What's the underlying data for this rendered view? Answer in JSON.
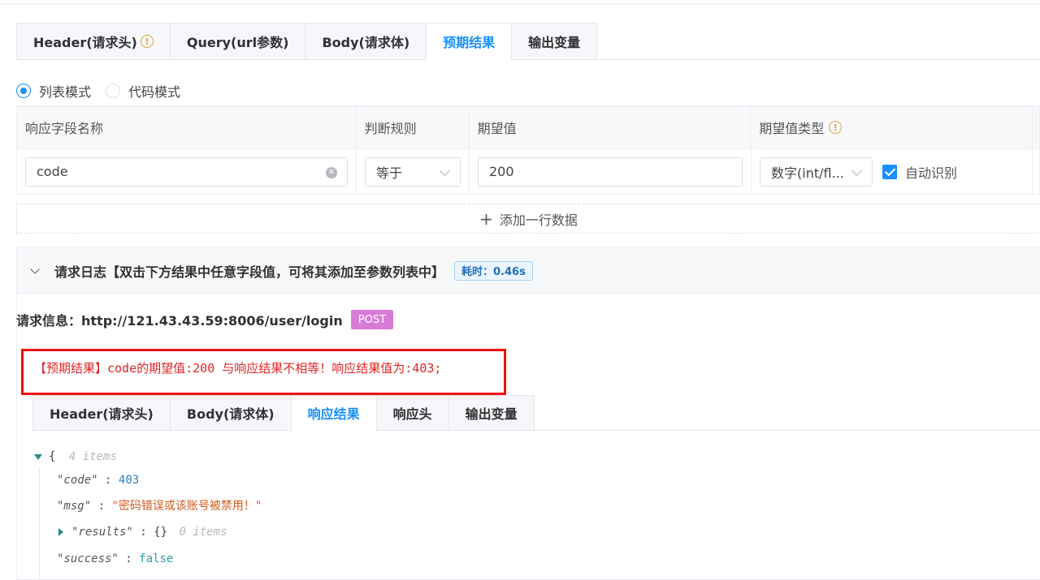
{
  "top_tabs": [
    {
      "label": "Header(请求头)",
      "has_warning": true
    },
    {
      "label": "Query(url参数)"
    },
    {
      "label": "Body(请求体)"
    },
    {
      "label": "预期结果",
      "active": true
    },
    {
      "label": "输出变量"
    }
  ],
  "mode": {
    "list_label": "列表模式",
    "code_label": "代码模式",
    "selected": "列表模式"
  },
  "table": {
    "headers": [
      "响应字段名称",
      "判断规则",
      "期望值",
      "期望值类型"
    ],
    "row": {
      "field_name": "code",
      "rule": "等于",
      "expected_value": "200",
      "value_type": "数字(int/fl...",
      "auto_detect_label": "自动识别",
      "auto_detect_checked": true
    },
    "add_row_label": "添加一行数据"
  },
  "log": {
    "title": "请求日志【双击下方结果中任意字段值，可将其添加至参数列表中】",
    "time_badge": "耗时：0.46s",
    "request_info_label": "请求信息：http://121.43.43.59:8006/user/login",
    "method_badge": "POST",
    "error_message": "【预期结果】code的期望值:200 与响应结果不相等！响应结果值为:403;",
    "tabs": [
      {
        "label": "Header(请求头)"
      },
      {
        "label": "Body(请求体)"
      },
      {
        "label": "响应结果",
        "active": true
      },
      {
        "label": "响应头"
      },
      {
        "label": "输出变量"
      }
    ]
  },
  "json": {
    "open_brace": "{",
    "items_count": "4 items",
    "code_key": "\"code\"",
    "code_value": "403",
    "msg_key": "\"msg\"",
    "msg_value": "\"密码错误或该账号被禁用！\"",
    "results_key": "\"results\"",
    "results_value": "{}",
    "results_count": "0 items",
    "success_key": "\"success\"",
    "success_value": "false",
    "colon": ":"
  },
  "colors": {
    "accent": "#1890ff",
    "error": "#e22424",
    "post_badge": "#d87bd8",
    "warning": "#e6a23c"
  }
}
